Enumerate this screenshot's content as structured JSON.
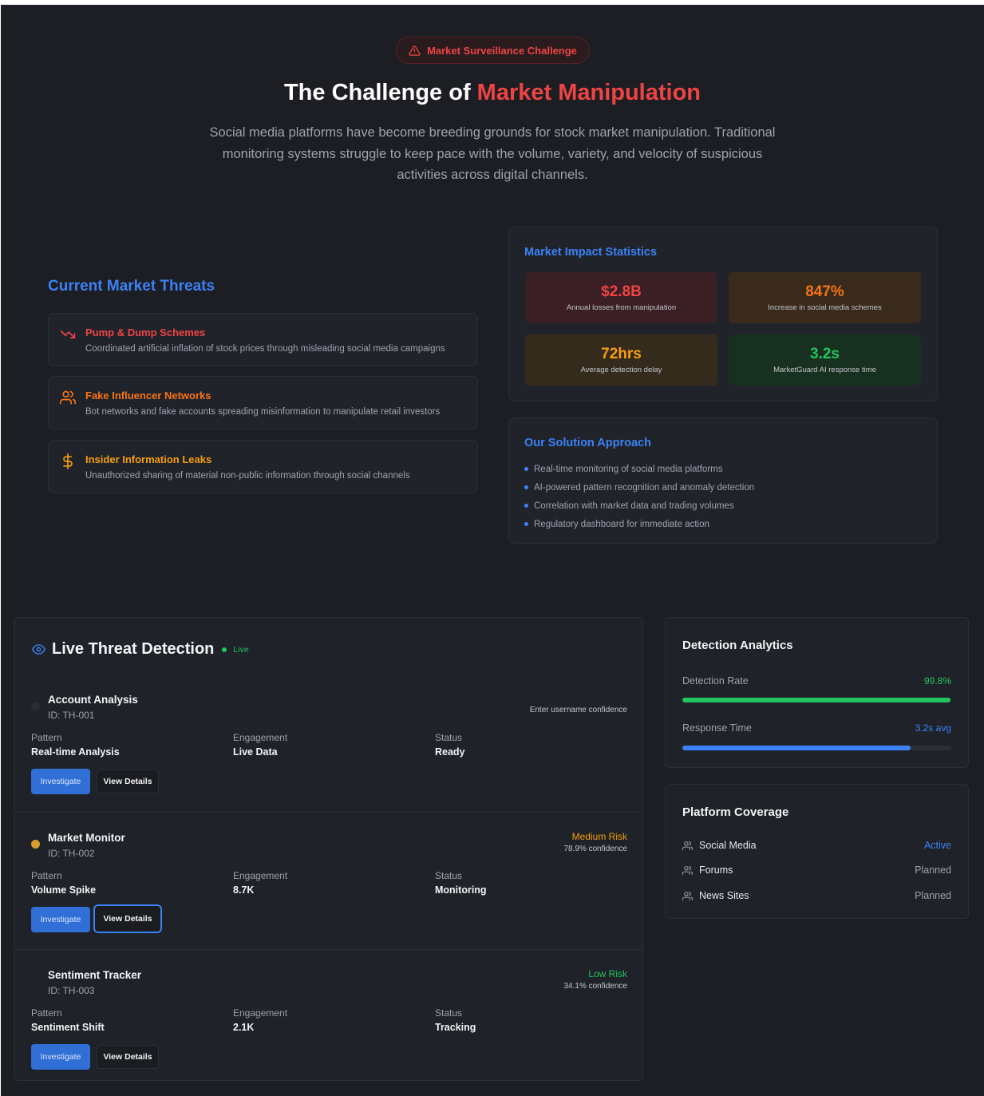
{
  "hero": {
    "badge": "Market Surveillance Challenge",
    "title_prefix": "The Challenge of ",
    "title_accent": "Market Manipulation",
    "description": "Social media platforms have become breeding grounds for stock market manipulation. Traditional monitoring systems struggle to keep pace with the volume, variety, and velocity of suspicious activities across digital channels."
  },
  "threats": {
    "title": "Current Market Threats",
    "items": [
      {
        "name": "Pump & Dump Schemes",
        "desc": "Coordinated artificial inflation of stock prices through misleading social media campaigns",
        "icon": "trending-down-icon",
        "color": "#ef4444"
      },
      {
        "name": "Fake Influencer Networks",
        "desc": "Bot networks and fake accounts spreading misinformation to manipulate retail investors",
        "icon": "users-icon",
        "color": "#f97316"
      },
      {
        "name": "Insider Information Leaks",
        "desc": "Unauthorized sharing of material non-public information through social channels",
        "icon": "dollar-icon",
        "color": "#f59e0b"
      }
    ]
  },
  "stats": {
    "title": "Market Impact Statistics",
    "items": [
      {
        "value": "$2.8B",
        "label": "Annual losses from manipulation",
        "color": "#ef4444",
        "bg": "#3a1f24"
      },
      {
        "value": "847%",
        "label": "Increase in social media schemes",
        "color": "#f97316",
        "bg": "#3a2a1c"
      },
      {
        "value": "72hrs",
        "label": "Average detection delay",
        "color": "#f59e0b",
        "bg": "#342b1c"
      },
      {
        "value": "3.2s",
        "label": "MarketGuard AI response time",
        "color": "#22c55e",
        "bg": "#18301f"
      }
    ]
  },
  "solution": {
    "title": "Our Solution Approach",
    "items": [
      "Real-time monitoring of social media platforms",
      "AI-powered pattern recognition and anomaly detection",
      "Correlation with market data and trading volumes",
      "Regulatory dashboard for immediate action"
    ]
  },
  "live": {
    "title": "Live Threat Detection",
    "badge": "Live",
    "field_labels": {
      "pattern": "Pattern",
      "engagement": "Engagement",
      "status": "Status"
    },
    "buttons": {
      "investigate": "Investigate",
      "view": "View Details"
    },
    "detections": [
      {
        "name": "Account Analysis",
        "id": "ID: TH-001",
        "risk": "",
        "confidence": "Enter username confidence",
        "pattern": "Real-time Analysis",
        "engagement": "Live Data",
        "status": "Ready",
        "dot_color": "#2a2d33",
        "risk_color": "#9ca3af"
      },
      {
        "name": "Market Monitor",
        "id": "ID: TH-002",
        "risk": "Medium Risk",
        "confidence": "78.9% confidence",
        "pattern": "Volume Spike",
        "engagement": "8.7K",
        "status": "Monitoring",
        "dot_color": "#d69e2e",
        "risk_color": "#f59e0b"
      },
      {
        "name": "Sentiment Tracker",
        "id": "ID: TH-003",
        "risk": "Low Risk",
        "confidence": "34.1% confidence",
        "pattern": "Sentiment Shift",
        "engagement": "2.1K",
        "status": "Tracking",
        "dot_color": "#1f2228",
        "risk_color": "#22c55e"
      }
    ]
  },
  "analytics": {
    "title": "Detection Analytics",
    "metrics": [
      {
        "label": "Detection Rate",
        "value": "99.8%",
        "fill": 0.998,
        "color": "#22c55e"
      },
      {
        "label": "Response Time",
        "value": "3.2s avg",
        "fill": 0.85,
        "color": "#3b82f6"
      }
    ]
  },
  "coverage": {
    "title": "Platform Coverage",
    "platforms": [
      {
        "name": "Social Media",
        "status": "Active",
        "color": "#3b82f6"
      },
      {
        "name": "Forums",
        "status": "Planned",
        "color": "#9ca3af"
      },
      {
        "name": "News Sites",
        "status": "Planned",
        "color": "#9ca3af"
      }
    ]
  }
}
